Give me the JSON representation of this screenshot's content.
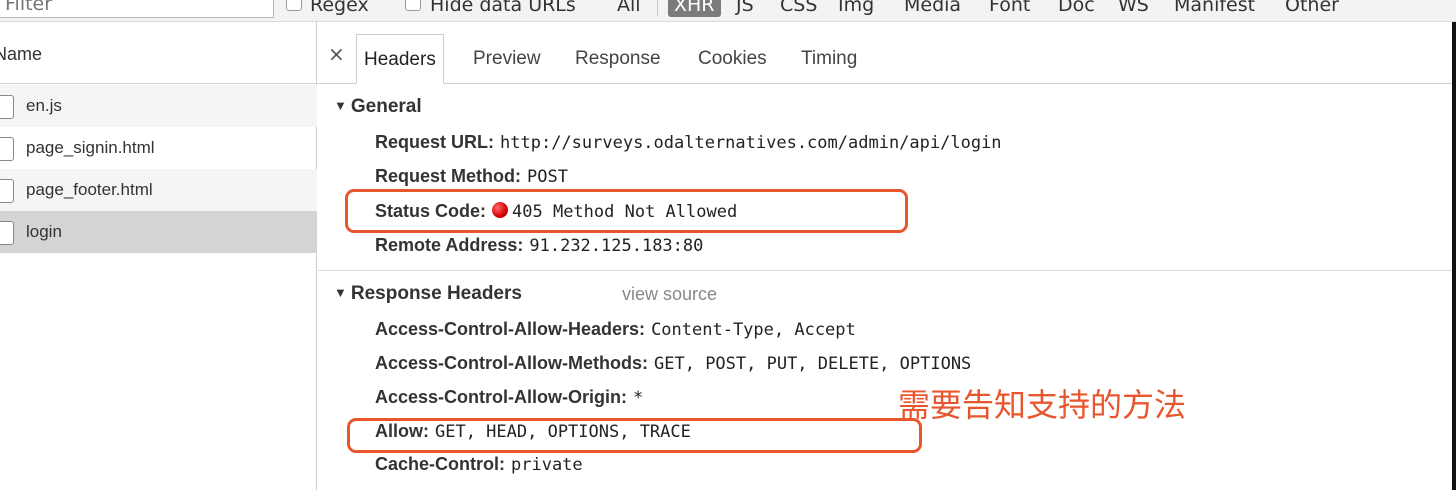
{
  "filterbar": {
    "filter_placeholder": "Filter",
    "regex_label": "Regex",
    "hide_data_urls_label": "Hide data URLs",
    "types": [
      "All",
      "XHR",
      "JS",
      "CSS",
      "Img",
      "Media",
      "Font",
      "Doc",
      "WS",
      "Manifest",
      "Other"
    ],
    "active_type": "XHR"
  },
  "requests": {
    "header": "Name",
    "items": [
      {
        "name": "en.js"
      },
      {
        "name": "page_signin.html"
      },
      {
        "name": "page_footer.html"
      },
      {
        "name": "login",
        "selected": true
      }
    ]
  },
  "tabs": {
    "close_glyph": "×",
    "items": [
      "Headers",
      "Preview",
      "Response",
      "Cookies",
      "Timing"
    ],
    "active": "Headers"
  },
  "general": {
    "title": "General",
    "rows": [
      {
        "key": "Request URL:",
        "value": "http://surveys.odalternatives.com/admin/api/login"
      },
      {
        "key": "Request Method:",
        "value": "POST"
      },
      {
        "key": "Status Code:",
        "value": "405 Method Not Allowed",
        "status_color": "#d10000"
      },
      {
        "key": "Remote Address:",
        "value": "91.232.125.183:80"
      }
    ]
  },
  "response_headers": {
    "title": "Response Headers",
    "view_source": "view source",
    "rows": [
      {
        "key": "Access-Control-Allow-Headers:",
        "value": "Content-Type, Accept"
      },
      {
        "key": "Access-Control-Allow-Methods:",
        "value": "GET, POST, PUT, DELETE, OPTIONS"
      },
      {
        "key": "Access-Control-Allow-Origin:",
        "value": "*"
      },
      {
        "key": "Allow:",
        "value": "GET, HEAD, OPTIONS, TRACE"
      },
      {
        "key": "Cache-Control:",
        "value": "private"
      }
    ]
  },
  "annotation": {
    "text": "需要告知支持的方法",
    "color": "#e8562e"
  }
}
